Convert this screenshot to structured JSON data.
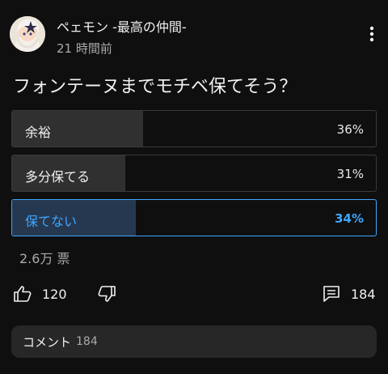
{
  "post": {
    "author": "ペェモン -最高の仲間-",
    "time": "21 時間前",
    "question": "フォンテーヌまでモチベ保てそう？"
  },
  "poll": {
    "options": [
      {
        "label": "余裕",
        "percent_text": "36%",
        "percent": 36,
        "selected": false
      },
      {
        "label": "多分保てる",
        "percent_text": "31%",
        "percent": 31,
        "selected": false
      },
      {
        "label": "保てない",
        "percent_text": "34%",
        "percent": 34,
        "selected": true
      }
    ],
    "votes": "2.6万 票"
  },
  "actions": {
    "like_count": "120",
    "comment_count": "184"
  },
  "comments": {
    "label": "コメント",
    "count": "184"
  },
  "colors": {
    "background": "#0f0f0f",
    "accent": "#3ea6ff",
    "bar_fill": "#303030",
    "selected_fill": "#263850",
    "comments_bg": "#272727"
  },
  "icons": {
    "avatar": "avatar-image",
    "more": "more-vertical-icon",
    "like": "thumbs-up-icon",
    "dislike": "thumbs-down-icon",
    "comment": "comment-icon"
  }
}
